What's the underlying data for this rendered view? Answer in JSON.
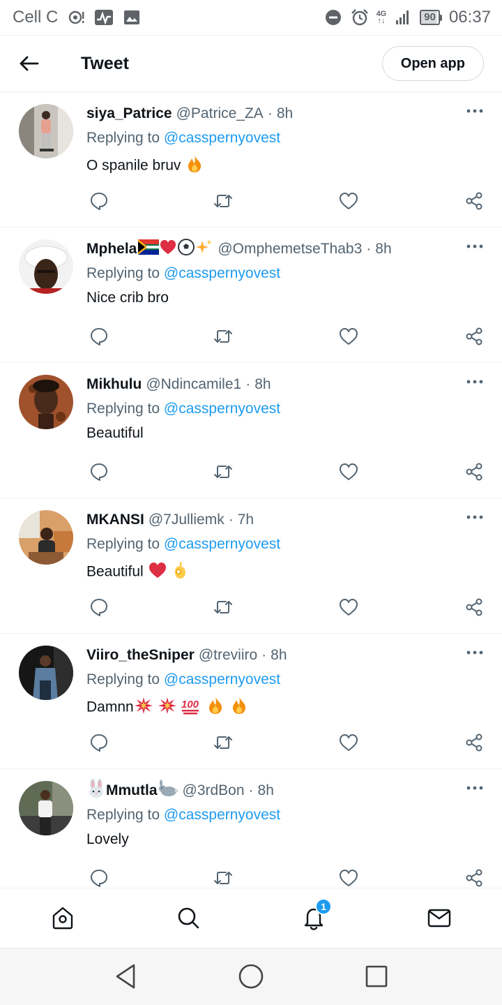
{
  "status_bar": {
    "carrier": "Cell C",
    "network": "4G",
    "battery": "90",
    "time": "06:37",
    "icons": [
      "hotspot-icon",
      "activity-icon",
      "image-icon",
      "dnd-icon",
      "alarm-icon",
      "signal-icon"
    ]
  },
  "header": {
    "title": "Tweet",
    "open_app_label": "Open app"
  },
  "reply_prefix": "Replying to",
  "tweets": [
    {
      "name": "siya_Patrice",
      "handle": "@Patrice_ZA",
      "time": "8h",
      "replying_to": "@casspernyovest",
      "text": "O spanile bruv",
      "emojis": [
        "fire"
      ]
    },
    {
      "name": "Mphela",
      "handle": "@OmphemetseThab3",
      "time": "8h",
      "replying_to": "@casspernyovest",
      "text": "Nice crib bro",
      "name_emojis": [
        "south-africa-flag",
        "red-heart",
        "soccer-ball",
        "sparkles"
      ]
    },
    {
      "name": "Mikhulu",
      "handle": "@Ndincamile1",
      "time": "8h",
      "replying_to": "@casspernyovest",
      "text": "Beautiful"
    },
    {
      "name": "MKANSI",
      "handle": "@7Julliemk",
      "time": "7h",
      "replying_to": "@casspernyovest",
      "text": "Beautiful",
      "emojis": [
        "red-heart",
        "ok-hand"
      ]
    },
    {
      "name": "Viiro_theSniper",
      "handle": "@treviiro",
      "time": "8h",
      "replying_to": "@casspernyovest",
      "text": "Damnn",
      "emojis": [
        "collision",
        "collision",
        "hundred-points",
        "fire",
        "fire"
      ]
    },
    {
      "name": "Mmutla",
      "handle": "@3rdBon",
      "time": "8h",
      "replying_to": "@casspernyovest",
      "text": "Lovely",
      "name_emojis": [
        "rabbit-face",
        "rabbit"
      ]
    }
  ],
  "bottom_nav": {
    "items": [
      "home-icon",
      "search-icon",
      "notifications-icon",
      "messages-icon"
    ],
    "notification_count": "1"
  },
  "system_nav": [
    "back-triangle-icon",
    "home-circle-icon",
    "recents-square-icon"
  ],
  "colors": {
    "link": "#1d9bf0",
    "secondary_text": "#536471",
    "primary_text": "#0f1419"
  }
}
